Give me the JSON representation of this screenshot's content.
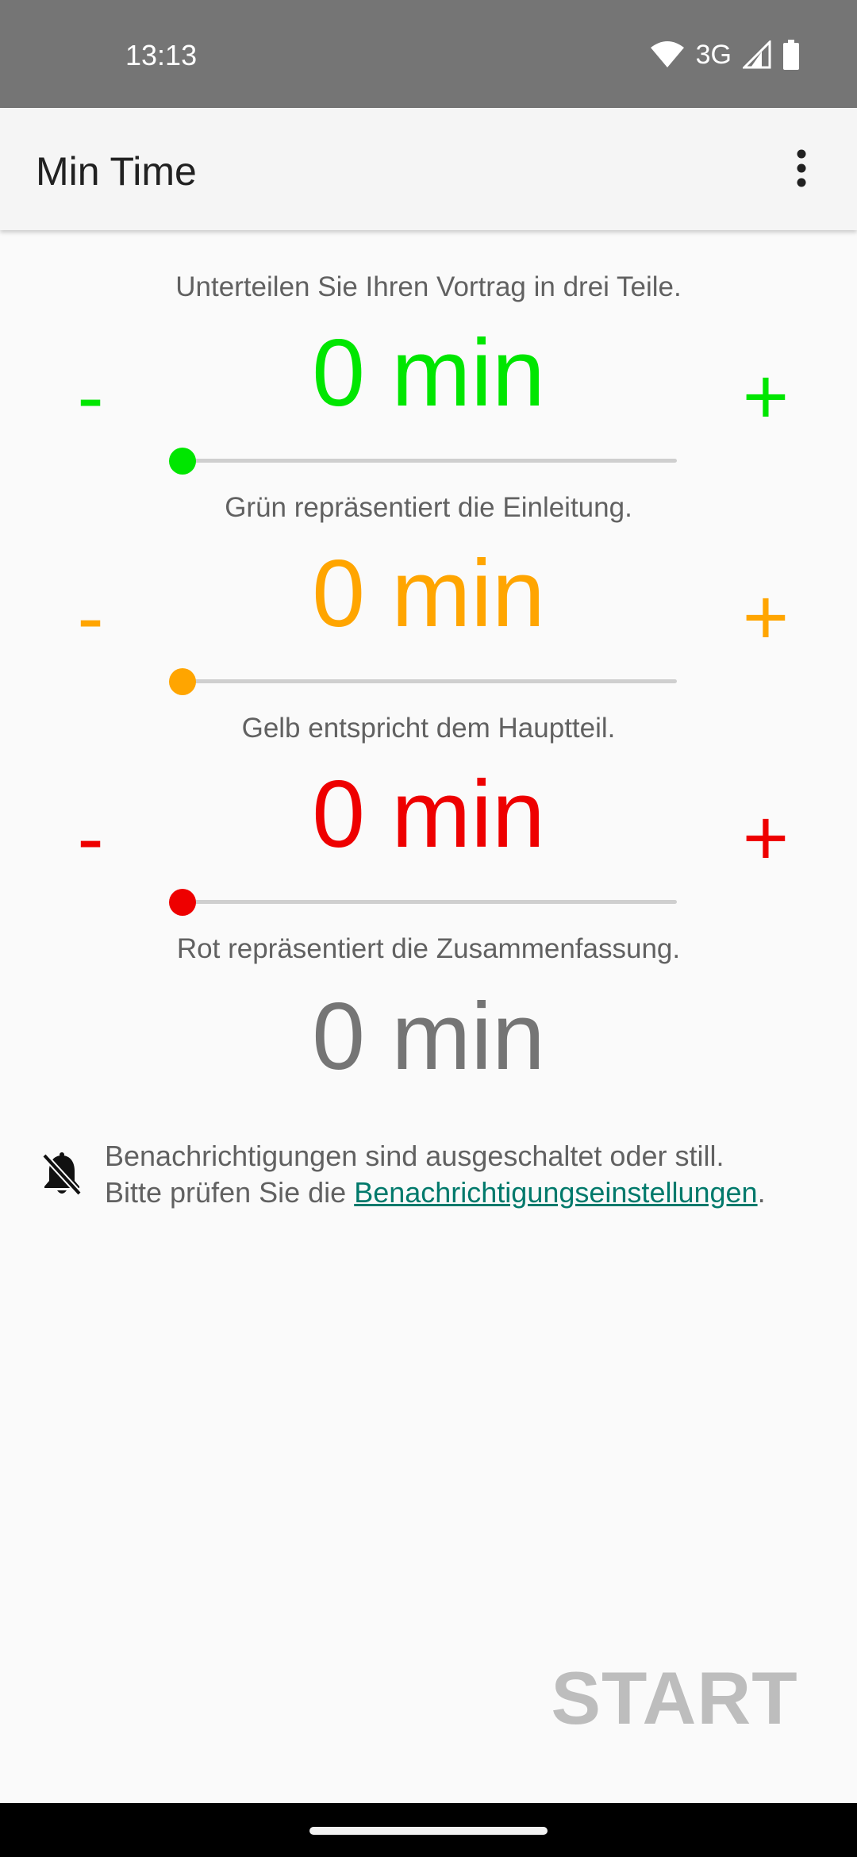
{
  "status_bar": {
    "time": "13:13",
    "network": "3G",
    "icons": [
      "wifi-icon",
      "signal-icon",
      "battery-icon"
    ]
  },
  "app_bar": {
    "title": "Min Time",
    "menu_icon": "more-vert-icon"
  },
  "intro": "Unterteilen Sie Ihren Vortrag in drei Teile.",
  "segments": [
    {
      "value": "0 min",
      "minus": "-",
      "plus": "+",
      "color": "#00e600",
      "slider_value": 0,
      "caption": "Grün repräsentiert die Einleitung."
    },
    {
      "value": "0 min",
      "minus": "-",
      "plus": "+",
      "color": "#ffa500",
      "slider_value": 0,
      "caption": "Gelb entspricht dem Hauptteil."
    },
    {
      "value": "0 min",
      "minus": "-",
      "plus": "+",
      "color": "#ee0000",
      "slider_value": 0,
      "caption": "Rot repräsentiert die Zusammenfassung."
    }
  ],
  "total": {
    "value": "0 min",
    "color": "#757575"
  },
  "notice": {
    "icon": "notifications-off-icon",
    "line1": "Benachrichtigungen sind ausgeschaltet oder still.",
    "line2_prefix": "Bitte prüfen Sie die ",
    "link": "Benachrichtigungseinstellungen",
    "line2_suffix": "."
  },
  "start_label": "START"
}
